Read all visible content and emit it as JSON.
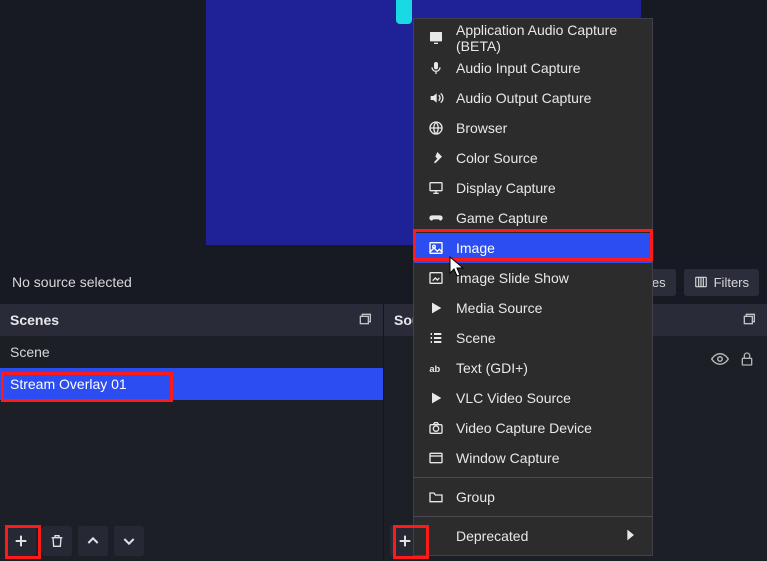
{
  "toolbar": {
    "status": "No source selected",
    "properties_label": "Properties",
    "filters_label": "Filters"
  },
  "panels": {
    "scenes": {
      "title": "Scenes",
      "items": [
        {
          "label": "Scene",
          "selected": false
        },
        {
          "label": "Stream Overlay 01",
          "selected": true
        }
      ]
    },
    "sources": {
      "title": "Sources"
    }
  },
  "context_menu": {
    "items": [
      {
        "icon": "app-audio-icon",
        "label": "Application Audio Capture (BETA)"
      },
      {
        "icon": "mic-icon",
        "label": "Audio Input Capture"
      },
      {
        "icon": "speaker-icon",
        "label": "Audio Output Capture"
      },
      {
        "icon": "globe-icon",
        "label": "Browser"
      },
      {
        "icon": "brush-icon",
        "label": "Color Source"
      },
      {
        "icon": "monitor-icon",
        "label": "Display Capture"
      },
      {
        "icon": "gamepad-icon",
        "label": "Game Capture"
      },
      {
        "icon": "image-icon",
        "label": "Image",
        "highlighted": true
      },
      {
        "icon": "slideshow-icon",
        "label": "Image Slide Show"
      },
      {
        "icon": "play-icon",
        "label": "Media Source"
      },
      {
        "icon": "list-icon",
        "label": "Scene"
      },
      {
        "icon": "text-icon",
        "label": "Text (GDI+)"
      },
      {
        "icon": "play-icon",
        "label": "VLC Video Source"
      },
      {
        "icon": "camera-icon",
        "label": "Video Capture Device"
      },
      {
        "icon": "window-icon",
        "label": "Window Capture"
      }
    ],
    "group_label": "Group",
    "deprecated_label": "Deprecated"
  }
}
